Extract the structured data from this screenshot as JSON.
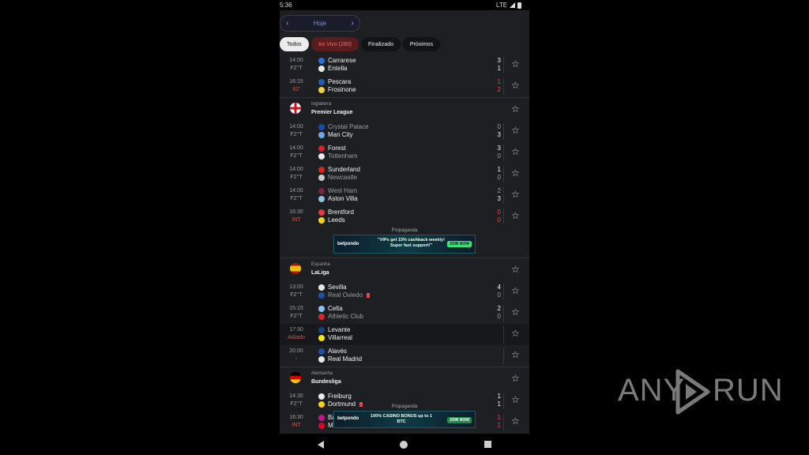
{
  "status": {
    "time": "5:36",
    "network": "LTE"
  },
  "datepicker": {
    "label": "Hoje",
    "prev": "‹",
    "next": "›"
  },
  "filters": [
    {
      "label": "Todos",
      "state": "active"
    },
    {
      "label": "Ao Vivo (280)",
      "state": "live"
    },
    {
      "label": "Finalizado",
      "state": "normal"
    },
    {
      "label": "Próximos",
      "state": "normal"
    }
  ],
  "items": [
    {
      "kind": "match",
      "time": "14:00",
      "status": "F2°T",
      "home": "Carrarese",
      "away": "Entella",
      "hs": "3",
      "as": "1",
      "crest1": "#2b6fd6",
      "crest2": "#e8e8e8"
    },
    {
      "kind": "match",
      "time": "16:15",
      "status": "62'",
      "statusRed": true,
      "live": true,
      "home": "Pescara",
      "away": "Frosinone",
      "hs": "1",
      "as": "2",
      "crest1": "#1f5db5",
      "crest2": "#f2d23c"
    },
    {
      "kind": "league",
      "country": "Inglaterra",
      "name": "Premier League",
      "flag": "england"
    },
    {
      "kind": "match",
      "time": "14:00",
      "status": "F2°T",
      "home": "Crystal Palace",
      "away": "Man City",
      "hs": "0",
      "as": "3",
      "winner": 2,
      "crest1": "#1b4ca8",
      "crest2": "#6cabdd"
    },
    {
      "kind": "match",
      "time": "14:00",
      "status": "F2°T",
      "home": "Forest",
      "away": "Tottenham",
      "hs": "3",
      "as": "0",
      "winner": 1,
      "crest1": "#d1232a",
      "crest2": "#e8e8e8"
    },
    {
      "kind": "match",
      "time": "14:00",
      "status": "F2°T",
      "home": "Sunderland",
      "away": "Newcastle",
      "hs": "1",
      "as": "0",
      "winner": 1,
      "crest1": "#d0261e",
      "crest2": "#cccccc"
    },
    {
      "kind": "match",
      "time": "14:00",
      "status": "F2°T",
      "home": "West Ham",
      "away": "Aston Villa",
      "hs": "2",
      "as": "3",
      "winner": 2,
      "crest1": "#7a263a",
      "crest2": "#95bfe5"
    },
    {
      "kind": "match",
      "time": "16:30",
      "status": "INT",
      "statusRed": true,
      "live": true,
      "home": "Brentford",
      "away": "Leeds",
      "hs": "0",
      "as": "0",
      "crest1": "#e03a3e",
      "crest2": "#f3d31e"
    },
    {
      "kind": "ad",
      "label": "Propaganda",
      "brand": "betpondo",
      "promo": "\"VIPs get 15% cashback weekly! Super fast support!\"",
      "cta": "JOIN NOW"
    },
    {
      "kind": "league",
      "country": "Espanha",
      "name": "LaLiga",
      "flag": "spain"
    },
    {
      "kind": "match",
      "time": "13:00",
      "status": "F2°T",
      "home": "Sevilla",
      "away": "Real Oviedo",
      "hs": "4",
      "as": "0",
      "winner": 1,
      "awayRed": true,
      "crest1": "#e8e8e8",
      "crest2": "#1e4fa3"
    },
    {
      "kind": "match",
      "time": "15:15",
      "status": "F2°T",
      "home": "Celta",
      "away": "Athletic Club",
      "hs": "2",
      "as": "0",
      "winner": 1,
      "crest1": "#8ac3ee",
      "crest2": "#d3262b"
    },
    {
      "kind": "match",
      "time": "17:30",
      "status": "Adiado",
      "statusRed": true,
      "highlight": true,
      "home": "Levante",
      "away": "Villarreal",
      "hs": "",
      "as": "",
      "crest1": "#1a3f8a",
      "crest2": "#f5e416"
    },
    {
      "kind": "match",
      "time": "20:00",
      "status": "-",
      "home": "Alavés",
      "away": "Real Madrid",
      "hs": "",
      "as": "",
      "crest1": "#1f4ea3",
      "crest2": "#e8e8e8"
    },
    {
      "kind": "league",
      "country": "Alemanha",
      "name": "Bundesliga",
      "flag": "germany"
    },
    {
      "kind": "match",
      "time": "14:30",
      "status": "F2°T",
      "home": "Freiburg",
      "away": "Dortmund",
      "hs": "1",
      "as": "1",
      "awayRed": true,
      "crest1": "#e8e8e8",
      "crest2": "#f7d117"
    },
    {
      "kind": "match",
      "time": "16:30",
      "status": "INT",
      "statusRed": true,
      "live": true,
      "home": "Ba",
      "away": "M",
      "hs": "1",
      "as": "1",
      "crest1": "#c1158b",
      "crest2": "#dc052d"
    }
  ],
  "adbottom": {
    "label": "Propaganda",
    "brand": "betpondo",
    "promo": "100% CASINO BONUS up to 1 BTC",
    "cta": "JOIN NOW"
  },
  "watermark": {
    "left": "ANY",
    "right": "RUN"
  },
  "colors": {
    "accent": "#7d91f0",
    "live": "#e5484d",
    "background": "#1d1f22"
  },
  "icons": {
    "star": "star-outline-icon",
    "back": "nav-back-icon",
    "home": "nav-home-icon",
    "recent": "nav-recent-icon"
  }
}
